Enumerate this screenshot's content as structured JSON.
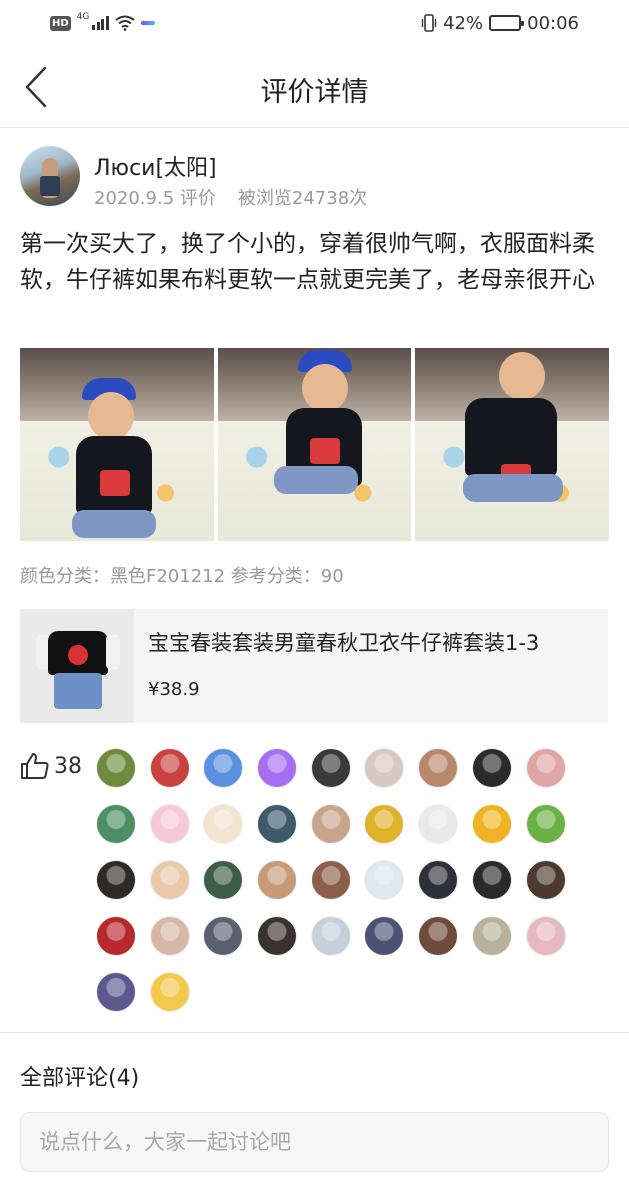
{
  "status_bar": {
    "hd": "HD",
    "network": "4G",
    "battery": "42%",
    "battery_level": 0.42,
    "time": "00:06"
  },
  "header": {
    "title": "评价详情",
    "back_icon": "chevron-left-icon"
  },
  "review": {
    "user_name": "Люси[太阳]",
    "date": "2020.9.5 评价",
    "views": "被浏览24738次",
    "content": "第一次买大了，换了个小的，穿着很帅气啊，衣服面料柔软，牛仔裤如果布料更软一点就更完美了，老母亲很开心",
    "sku": "颜色分类：黑色F201212 参考分类：90"
  },
  "product": {
    "title": "宝宝春装套装男童春秋卫衣牛仔裤套装1-3",
    "price": "¥38.9"
  },
  "likes": {
    "count": "38",
    "icon": "thumbs-up-icon",
    "avatar_colors": [
      "#6d8b3f",
      "#c8423f",
      "#5b8fe0",
      "#a66ef0",
      "#3a3a3a",
      "#d9c9c0",
      "#b7896a",
      "#2b2b2b",
      "#e0a6a6",
      "#4c8f63",
      "#f7c8d8",
      "#f3e3cf",
      "#3f5a6a",
      "#c7a48a",
      "#e0b22a",
      "#e9e9e9",
      "#f0b323",
      "#6cb144",
      "#2e2a28",
      "#e8c9a8",
      "#3b5e45",
      "#c79a78",
      "#8d5f4a",
      "#dfe7ef",
      "#2f2f38",
      "#2a2a2a",
      "#4b3a2d",
      "#b8282c",
      "#d7b7a8",
      "#5a6070",
      "#3a322e",
      "#c6d0da",
      "#4a5472",
      "#6e4b3c",
      "#b9b29a",
      "#e6b9c0",
      "#5e5891",
      "#f2c94c"
    ]
  },
  "comments": {
    "title": "全部评论(4)",
    "placeholder": "说点什么，大家一起讨论吧"
  }
}
